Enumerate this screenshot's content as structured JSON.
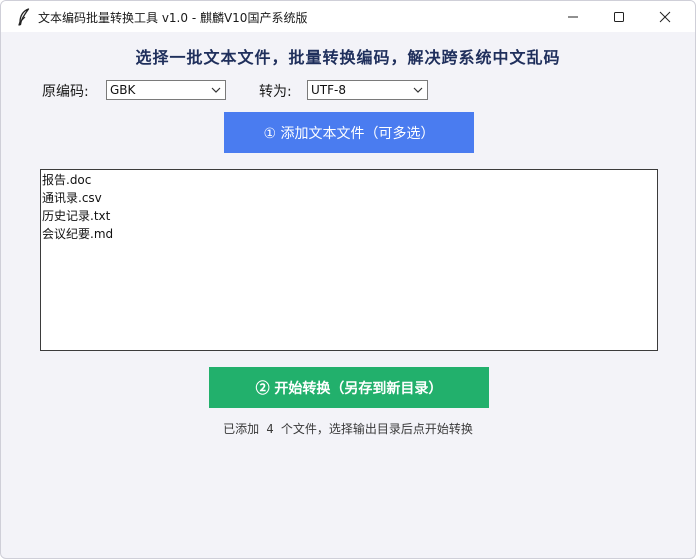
{
  "window": {
    "title": "文本编码批量转换工具 v1.0 - 麒麟V10国产系统版"
  },
  "main": {
    "headline": "选择一批文本文件，批量转换编码，解决跨系统中文乱码",
    "source_encoding": {
      "label": "原编码:",
      "value": "GBK"
    },
    "target_encoding": {
      "label": "转为:",
      "value": "UTF-8"
    },
    "add_button_label": "①  添加文本文件（可多选）",
    "files": [
      "报告.doc",
      "通讯录.csv",
      "历史记录.txt",
      "会议纪要.md"
    ],
    "start_button_label": "②  开始转换（另存到新目录）",
    "status_text": "已添加 4 个文件，选择输出目录后点开始转换"
  },
  "colors": {
    "add_button": "#4a7cf0",
    "start_button": "#22b06c",
    "headline": "#1f2f5c"
  },
  "icons": [
    "feather-icon",
    "minimize-icon",
    "maximize-icon",
    "close-icon",
    "chevron-down-icon"
  ]
}
